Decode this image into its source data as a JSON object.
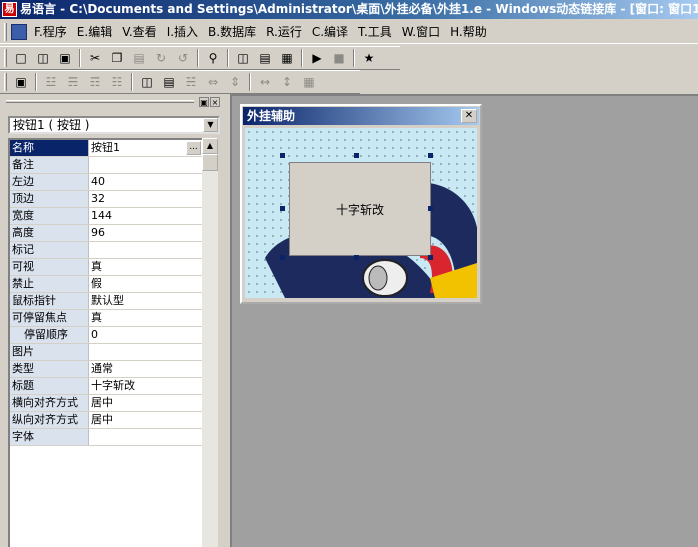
{
  "window": {
    "title": "易语言 - C:\\Documents and Settings\\Administrator\\桌面\\外挂必备\\外挂1.e - Windows动态链接库 - [窗口: 窗口1]"
  },
  "menu": [
    {
      "label": "F.程序"
    },
    {
      "label": "E.编辑"
    },
    {
      "label": "V.查看"
    },
    {
      "label": "I.插入"
    },
    {
      "label": "B.数据库"
    },
    {
      "label": "R.运行"
    },
    {
      "label": "C.编译"
    },
    {
      "label": "T.工具"
    },
    {
      "label": "W.窗口"
    },
    {
      "label": "H.帮助"
    }
  ],
  "toolbar_icons": {
    "row1": [
      "new-file-icon",
      "open-folder-icon",
      "save-icon",
      "cut-icon",
      "copy-icon",
      "paste-icon",
      "redo-icon",
      "undo-icon",
      "find-icon",
      "layout1-icon",
      "layout2-icon",
      "layout3-icon",
      "run-icon",
      "stop-icon",
      "debug-icon"
    ],
    "row2": [
      "form-icon",
      "align-left-icon",
      "align-center-icon",
      "align-right-icon",
      "align-top-icon",
      "center-horizontal-icon",
      "center-vertical-icon",
      "align-bottom-icon",
      "space-horizontal-icon",
      "space-vertical-icon",
      "same-width-icon",
      "same-height-icon",
      "same-size-icon"
    ]
  },
  "properties": {
    "selector": "按钮1 ( 按钮 )",
    "rows": [
      {
        "name": "名称",
        "value": "按钮1"
      },
      {
        "name": "备注",
        "value": ""
      },
      {
        "name": "左边",
        "value": "40"
      },
      {
        "name": "顶边",
        "value": "32"
      },
      {
        "name": "宽度",
        "value": "144"
      },
      {
        "name": "高度",
        "value": "96"
      },
      {
        "name": "标记",
        "value": ""
      },
      {
        "name": "可视",
        "value": "真"
      },
      {
        "name": "禁止",
        "value": "假"
      },
      {
        "name": "鼠标指针",
        "value": "默认型"
      },
      {
        "name": "可停留焦点",
        "value": "真"
      },
      {
        "name": "停留顺序",
        "value": "0"
      },
      {
        "name": "图片",
        "value": ""
      },
      {
        "name": "类型",
        "value": "通常"
      },
      {
        "name": "标题",
        "value": "十字斩改"
      },
      {
        "name": "横向对齐方式",
        "value": "居中"
      },
      {
        "name": "纵向对齐方式",
        "value": "居中"
      },
      {
        "name": "字体",
        "value": ""
      }
    ],
    "ellipsis": "..."
  },
  "form": {
    "title": "外挂辅助",
    "close": "✕",
    "button_caption": "十字斩改"
  },
  "colors": {
    "selection": "#0a246a",
    "form_bg": "#c8e8f4",
    "surface": "#a0a0a0"
  }
}
